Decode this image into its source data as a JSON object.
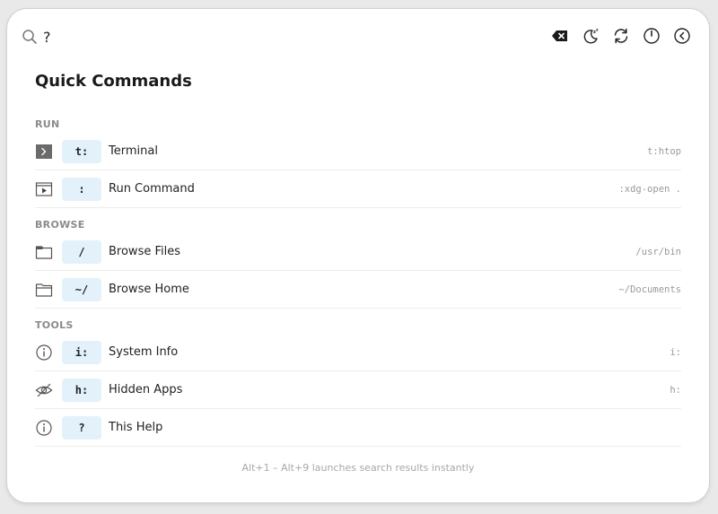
{
  "search": {
    "value": "?",
    "placeholder": ""
  },
  "toolbar": {
    "clear_icon": "backspace-icon",
    "sleep_icon": "moon-sleep-icon",
    "refresh_icon": "refresh-icon",
    "power_icon": "power-icon",
    "back_icon": "back-icon"
  },
  "title": "Quick Commands",
  "sections": [
    {
      "label": "RUN",
      "items": [
        {
          "icon": "terminal-icon",
          "prefix": "t:",
          "label": "Terminal",
          "example": "t:htop"
        },
        {
          "icon": "run-window-icon",
          "prefix": ":",
          "label": "Run Command",
          "example": ":xdg-open ."
        }
      ]
    },
    {
      "label": "BROWSE",
      "items": [
        {
          "icon": "folder-icon",
          "prefix": "/",
          "label": "Browse Files",
          "example": "/usr/bin"
        },
        {
          "icon": "folder-open-icon",
          "prefix": "~/",
          "label": "Browse Home",
          "example": "~/Documents"
        }
      ]
    },
    {
      "label": "TOOLS",
      "items": [
        {
          "icon": "info-icon",
          "prefix": "i:",
          "label": "System Info",
          "example": "i:"
        },
        {
          "icon": "eye-off-icon",
          "prefix": "h:",
          "label": "Hidden Apps",
          "example": "h:"
        },
        {
          "icon": "info-icon",
          "prefix": "?",
          "label": "This Help",
          "example": ""
        }
      ]
    }
  ],
  "footer": "Alt+1 – Alt+9 launches search results instantly",
  "colors": {
    "prefix_bg": "#e3f1fb",
    "muted_text": "#9a9a9a"
  }
}
